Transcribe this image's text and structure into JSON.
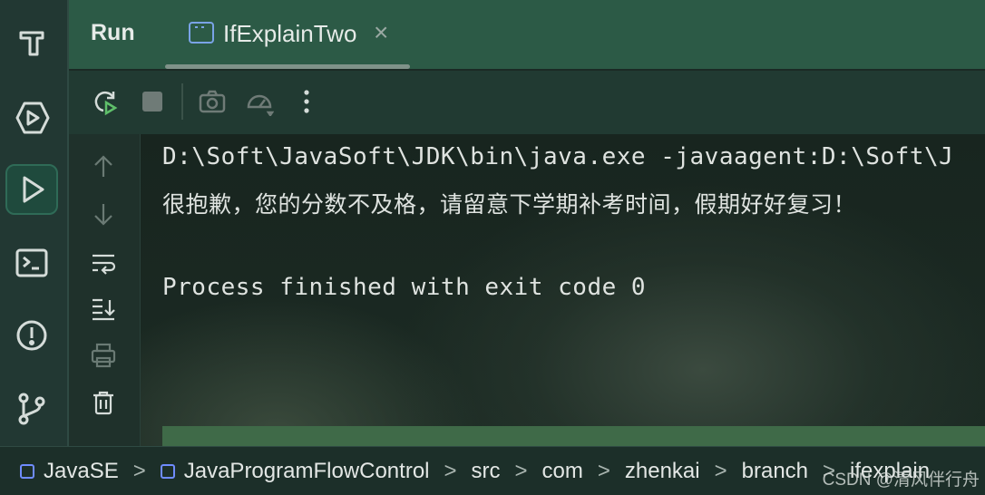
{
  "header": {
    "title": "Run",
    "tab": {
      "label": "IfExplainTwo",
      "icon": "console-window-icon",
      "close": "×"
    }
  },
  "leftbar": {
    "items": [
      {
        "name": "build-hammer-icon"
      },
      {
        "name": "services-icon"
      },
      {
        "name": "run-icon",
        "active": true
      },
      {
        "name": "terminal-icon"
      },
      {
        "name": "problems-icon"
      },
      {
        "name": "git-branch-icon"
      }
    ]
  },
  "toolbar": {
    "items": [
      "rerun-icon",
      "stop-icon",
      "screenshot-icon",
      "profiler-icon",
      "more-icon"
    ]
  },
  "sidecol": {
    "items": [
      "up-arrow-icon",
      "down-arrow-icon",
      "soft-wrap-icon",
      "scroll-to-end-icon",
      "print-icon",
      "trash-icon"
    ]
  },
  "console": {
    "lines": [
      "D:\\Soft\\JavaSoft\\JDK\\bin\\java.exe -javaagent:D:\\Soft\\J",
      "很抱歉，您的分数不及格，请留意下学期补考时间，假期好好复习！",
      "",
      "Process finished with exit code 0"
    ]
  },
  "breadcrumb": {
    "items": [
      "JavaSE",
      "JavaProgramFlowControl",
      "src",
      "com",
      "zhenkai",
      "branch",
      "ifexplain"
    ],
    "separator": ">"
  },
  "watermark": "CSDN @清风伴行舟",
  "colors": {
    "header_bg": "#2c5a46",
    "console_bg": "#18251f",
    "module_icon": "#6f8cff"
  }
}
